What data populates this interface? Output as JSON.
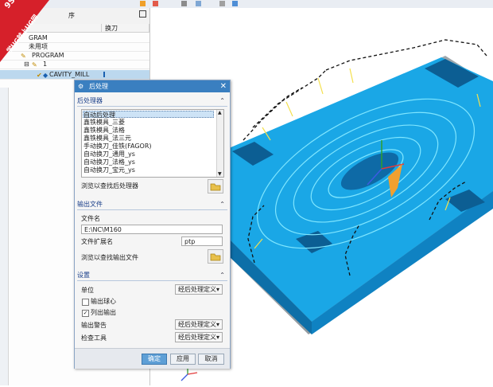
{
  "navigator": {
    "header": "序",
    "columns": [
      "",
      "换刀"
    ],
    "tree": [
      {
        "label": "GRAM",
        "indent": 36
      },
      {
        "label": "未用项",
        "indent": 36
      },
      {
        "label": "PROGRAM",
        "indent": 40
      },
      {
        "label": "1",
        "indent": 54
      },
      {
        "label": "CAVITY_MILL",
        "indent": 62
      }
    ]
  },
  "logo": {
    "line1": "9SUG",
    "line2": "学UG就上UG网"
  },
  "dialog": {
    "title": "后处理",
    "sections": {
      "postprocessor": "后处理器",
      "output_file": "输出文件",
      "settings": "设置"
    },
    "postprocessors": [
      "自动后处理",
      "鑫铁模具_三菱",
      "鑫铁模具_法格",
      "鑫铁模具_法三元",
      "手动换刀_佳铁(FAGOR)",
      "自动换刀_通用_ys",
      "自动换刀_法格_ys",
      "自动换刀_宝元_ys"
    ],
    "browse_post": "浏览以查找后处理器",
    "filename_label": "文件名",
    "filename_value": "E:\\NC\\M160",
    "ext_label": "文件扩展名",
    "ext_value": "ptp",
    "browse_output": "浏览以查找输出文件",
    "unit_label": "单位",
    "unit_value": "经后处理定义",
    "output_ball_center": "输出球心",
    "list_output": "列出输出",
    "warning_label": "输出警告",
    "warning_value": "经后处理定义",
    "check_label": "检查工具",
    "check_value": "经后处理定义",
    "ok": "确定",
    "apply": "应用",
    "cancel": "取消"
  },
  "colors": {
    "accent": "#3a7fc0",
    "part": "#1aa7e6",
    "toolpath": "#6fe0ff",
    "plate": "#9aa3a8"
  }
}
